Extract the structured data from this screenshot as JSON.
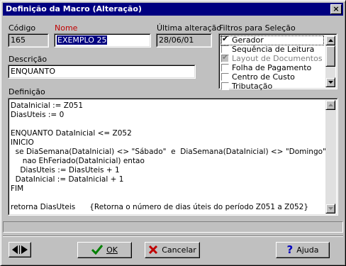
{
  "window": {
    "title": "Definição da Macro (Alteração)",
    "close_glyph": "×"
  },
  "fields": {
    "codigo_label": "Código",
    "codigo_value": "165",
    "nome_label": "Nome",
    "nome_value": "EXEMPLO 25",
    "ultima_label": "Última alteração",
    "ultima_value": "28/06/01",
    "descricao_label": "Descrição",
    "descricao_value": "ENQUANTO",
    "definicao_label": "Definição"
  },
  "filtros": {
    "label": "Filtros para Seleção",
    "items": [
      {
        "label": "Gerador",
        "checked": "✔"
      },
      {
        "label": "Sequência de Leitura",
        "checked": ""
      },
      {
        "label": "Layout de Documentos",
        "checked": "✔"
      },
      {
        "label": "Folha de Pagamento",
        "checked": ""
      },
      {
        "label": "Centro de Custo",
        "checked": ""
      },
      {
        "label": "Tributação",
        "checked": ""
      }
    ]
  },
  "definicao_lines": [
    "DataInicial := Z051",
    "DiasUteis := 0",
    "",
    "ENQUANTO DataInicial <= Z052",
    "INICIO",
    "  se DiaSemana(DataInicial) <> \"Sábado\"  e  DiaSemana(DataInicial) <> \"Domingo\"  e",
    "     nao EhFeriado(DataInicial) entao",
    "    DiasUteis := DiasUteis + 1",
    "  DataInicial := DataInicial + 1",
    "FIM",
    "",
    "retorna DiasUteis      {Retorna o número de dias úteis do período Z051 a Z052}"
  ],
  "buttons": {
    "ok": "OK",
    "cancelar": "Cancelar",
    "ajuda": "Ajuda"
  },
  "colors": {
    "ok_icon": "#008000",
    "cancel_icon": "#c00000",
    "help_icon": "#0000c0",
    "title_bg": "#000080"
  }
}
